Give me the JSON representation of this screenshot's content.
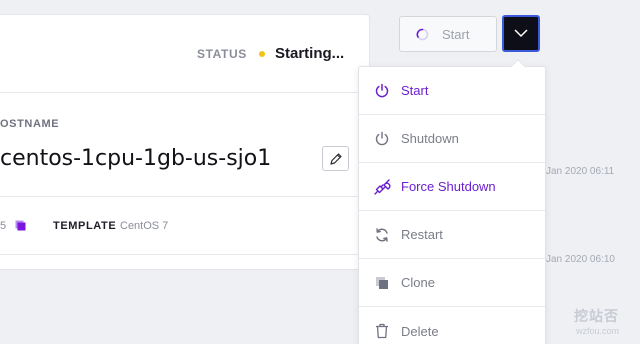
{
  "server": {
    "status_label": "STATUS",
    "status_value": "Starting...",
    "hostname_label": "OSTNAME",
    "hostname_value": "centos-1cpu-1gb-us-sjo1",
    "os_number": "5",
    "template_label": "TEMPLATE",
    "template_value": "CentOS 7"
  },
  "toolbar": {
    "start_label": "Start"
  },
  "menu": {
    "items": [
      {
        "label": "Start",
        "icon": "power-icon"
      },
      {
        "label": "Shutdown",
        "icon": "power-icon"
      },
      {
        "label": "Force Shutdown",
        "icon": "plug-icon"
      },
      {
        "label": "Restart",
        "icon": "refresh-icon"
      },
      {
        "label": "Clone",
        "icon": "clone-icon"
      },
      {
        "label": "Delete",
        "icon": "trash-icon"
      }
    ]
  },
  "dates": [
    "Jan 2020 06:11",
    "Jan 2020 06:10"
  ],
  "watermark": {
    "main": "挖站否",
    "sub": "wzfou.com"
  },
  "colors": {
    "accent": "#6b1fd1",
    "status_dot": "#f3c316",
    "dropdown_bg": "#0d0e17",
    "dropdown_border": "#3b5ad9"
  }
}
